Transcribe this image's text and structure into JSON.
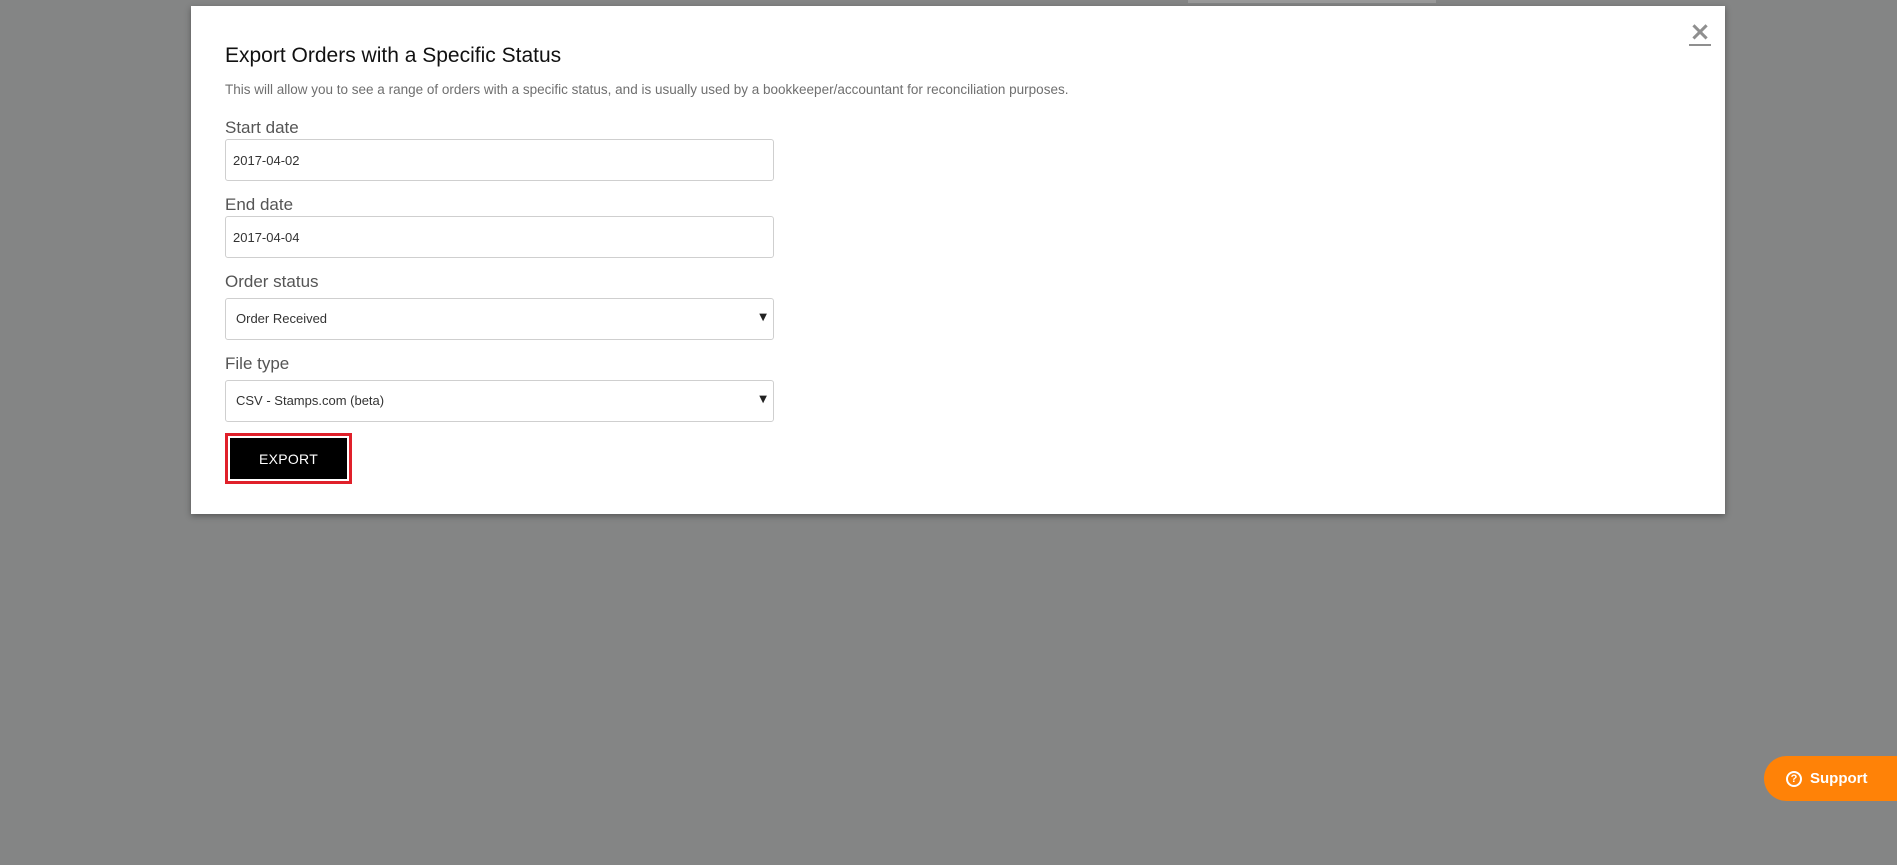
{
  "modal": {
    "close_glyph": "×",
    "title": "Export Orders with a Specific Status",
    "description": "This will allow you to see a range of orders with a specific status, and is usually used by a bookkeeper/accountant for reconciliation purposes.",
    "fields": {
      "start_date": {
        "label": "Start date",
        "value": "2017-04-02"
      },
      "end_date": {
        "label": "End date",
        "value": "2017-04-04"
      },
      "order_status": {
        "label": "Order status",
        "selected": "Order Received",
        "caret": "▼"
      },
      "file_type": {
        "label": "File type",
        "selected": "CSV - Stamps.com (beta)",
        "caret": "▼"
      }
    },
    "export_label": "EXPORT"
  },
  "support": {
    "label": "Support",
    "icon_glyph": "?"
  },
  "colors": {
    "overlay": "#848585",
    "support_orange": "#ff8207",
    "highlight_red": "#e0202a",
    "export_black": "#000000"
  }
}
